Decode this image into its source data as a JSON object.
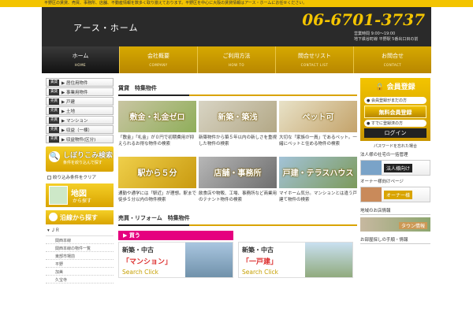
{
  "topbar": "平野区の賃貸、売買、事務所、店舗、不動産情報を数多く取り揃えております。平野区を中心に大阪の賃貸情報はアース・ホームにお任せください。",
  "header": {
    "logo": "アース・ホーム",
    "phone": "06-6701-3737",
    "hours": "営業時間 9:00～19:00",
    "address": "地下鉄谷町線 平野駅 5番出口目の前"
  },
  "nav": [
    {
      "jp": "ホーム",
      "en": "HOME"
    },
    {
      "jp": "会社概要",
      "en": "COMPANY"
    },
    {
      "jp": "ご利用方法",
      "en": "HOW TO"
    },
    {
      "jp": "問合せリスト",
      "en": "CONTACT LIST"
    },
    {
      "jp": "お問合せ",
      "en": "CONTACT"
    }
  ],
  "sidebar": {
    "categories": [
      {
        "tag": "賃貸",
        "label": "居住用物件"
      },
      {
        "tag": "賃貸",
        "label": "事業用物件"
      },
      {
        "tag": "売買",
        "label": "戸建"
      },
      {
        "tag": "売買",
        "label": "土地"
      },
      {
        "tag": "売買",
        "label": "マンション"
      },
      {
        "tag": "売買",
        "label": "収益（一棟）"
      },
      {
        "tag": "売買",
        "label": "収益物件(区分)"
      }
    ],
    "search_banner": {
      "title": "しぼりこみ検索",
      "sub": "条件を絞り込んで探す"
    },
    "clear_label": "絞り込み条件をクリア",
    "map_banner": {
      "title": "地図",
      "sub": "から探す"
    },
    "line_banner": "沿線から探す",
    "jr_label": "ＪＲ",
    "lines": [
      "関西本線",
      "関西本線の物件一覧",
      "東部市場前",
      "平野",
      "加美",
      "久宝寺"
    ]
  },
  "main": {
    "rent_title": "賃貸　特集物件",
    "rent_cards": [
      {
        "caption": "敷金・礼金ゼロ",
        "desc": "「敷金」「礼金」が０円で初期費用が抑えられるお得な物件の検索"
      },
      {
        "caption": "新築・築浅",
        "desc": "新築物件から築５年以内の新しさを重視した物件の検索"
      },
      {
        "caption": "ペット可",
        "desc": "大切な「家族の一員」であるペット。一緒にペットと住める物件の検索"
      },
      {
        "caption": "駅から５分",
        "desc": "通勤や通学には「駅近」が理想。駅まで徒歩５分以内の物件検索"
      },
      {
        "caption": "店舗・事務所",
        "desc": "飲食店や物販、工場、事務所など商業用のテナント物件の検索"
      },
      {
        "caption": "戸建・テラスハウス",
        "desc": "マイホーム気分。マンションとは違う戸建て物件の検索"
      }
    ],
    "buy_title": "売買・リフォーム　特集物件",
    "buy_tab": "買う",
    "buy_cards": [
      {
        "kind": "新築・中古",
        "main": "「マンション」",
        "cta": "Search Click"
      },
      {
        "kind": "新築・中古",
        "main": "「一戸建」",
        "cta": "Search Click"
      }
    ]
  },
  "right": {
    "member_title": "会員登録",
    "member_link1": "会員登録がまだの方",
    "register": "無料会員登録",
    "member_link2": "すでに登録済の方",
    "login": "ログイン",
    "forgot": "パスワードを忘れた場合",
    "corp_text": "法人様の社宅の一括管理",
    "corp_banner": "法人様向け",
    "owner_text": "オーナー様向けページ",
    "owner_banner": "オーナー様",
    "area_title": "地域のお店情報",
    "area_banner": "タウン情報",
    "move_title": "お部屋探しの手順・情報"
  }
}
